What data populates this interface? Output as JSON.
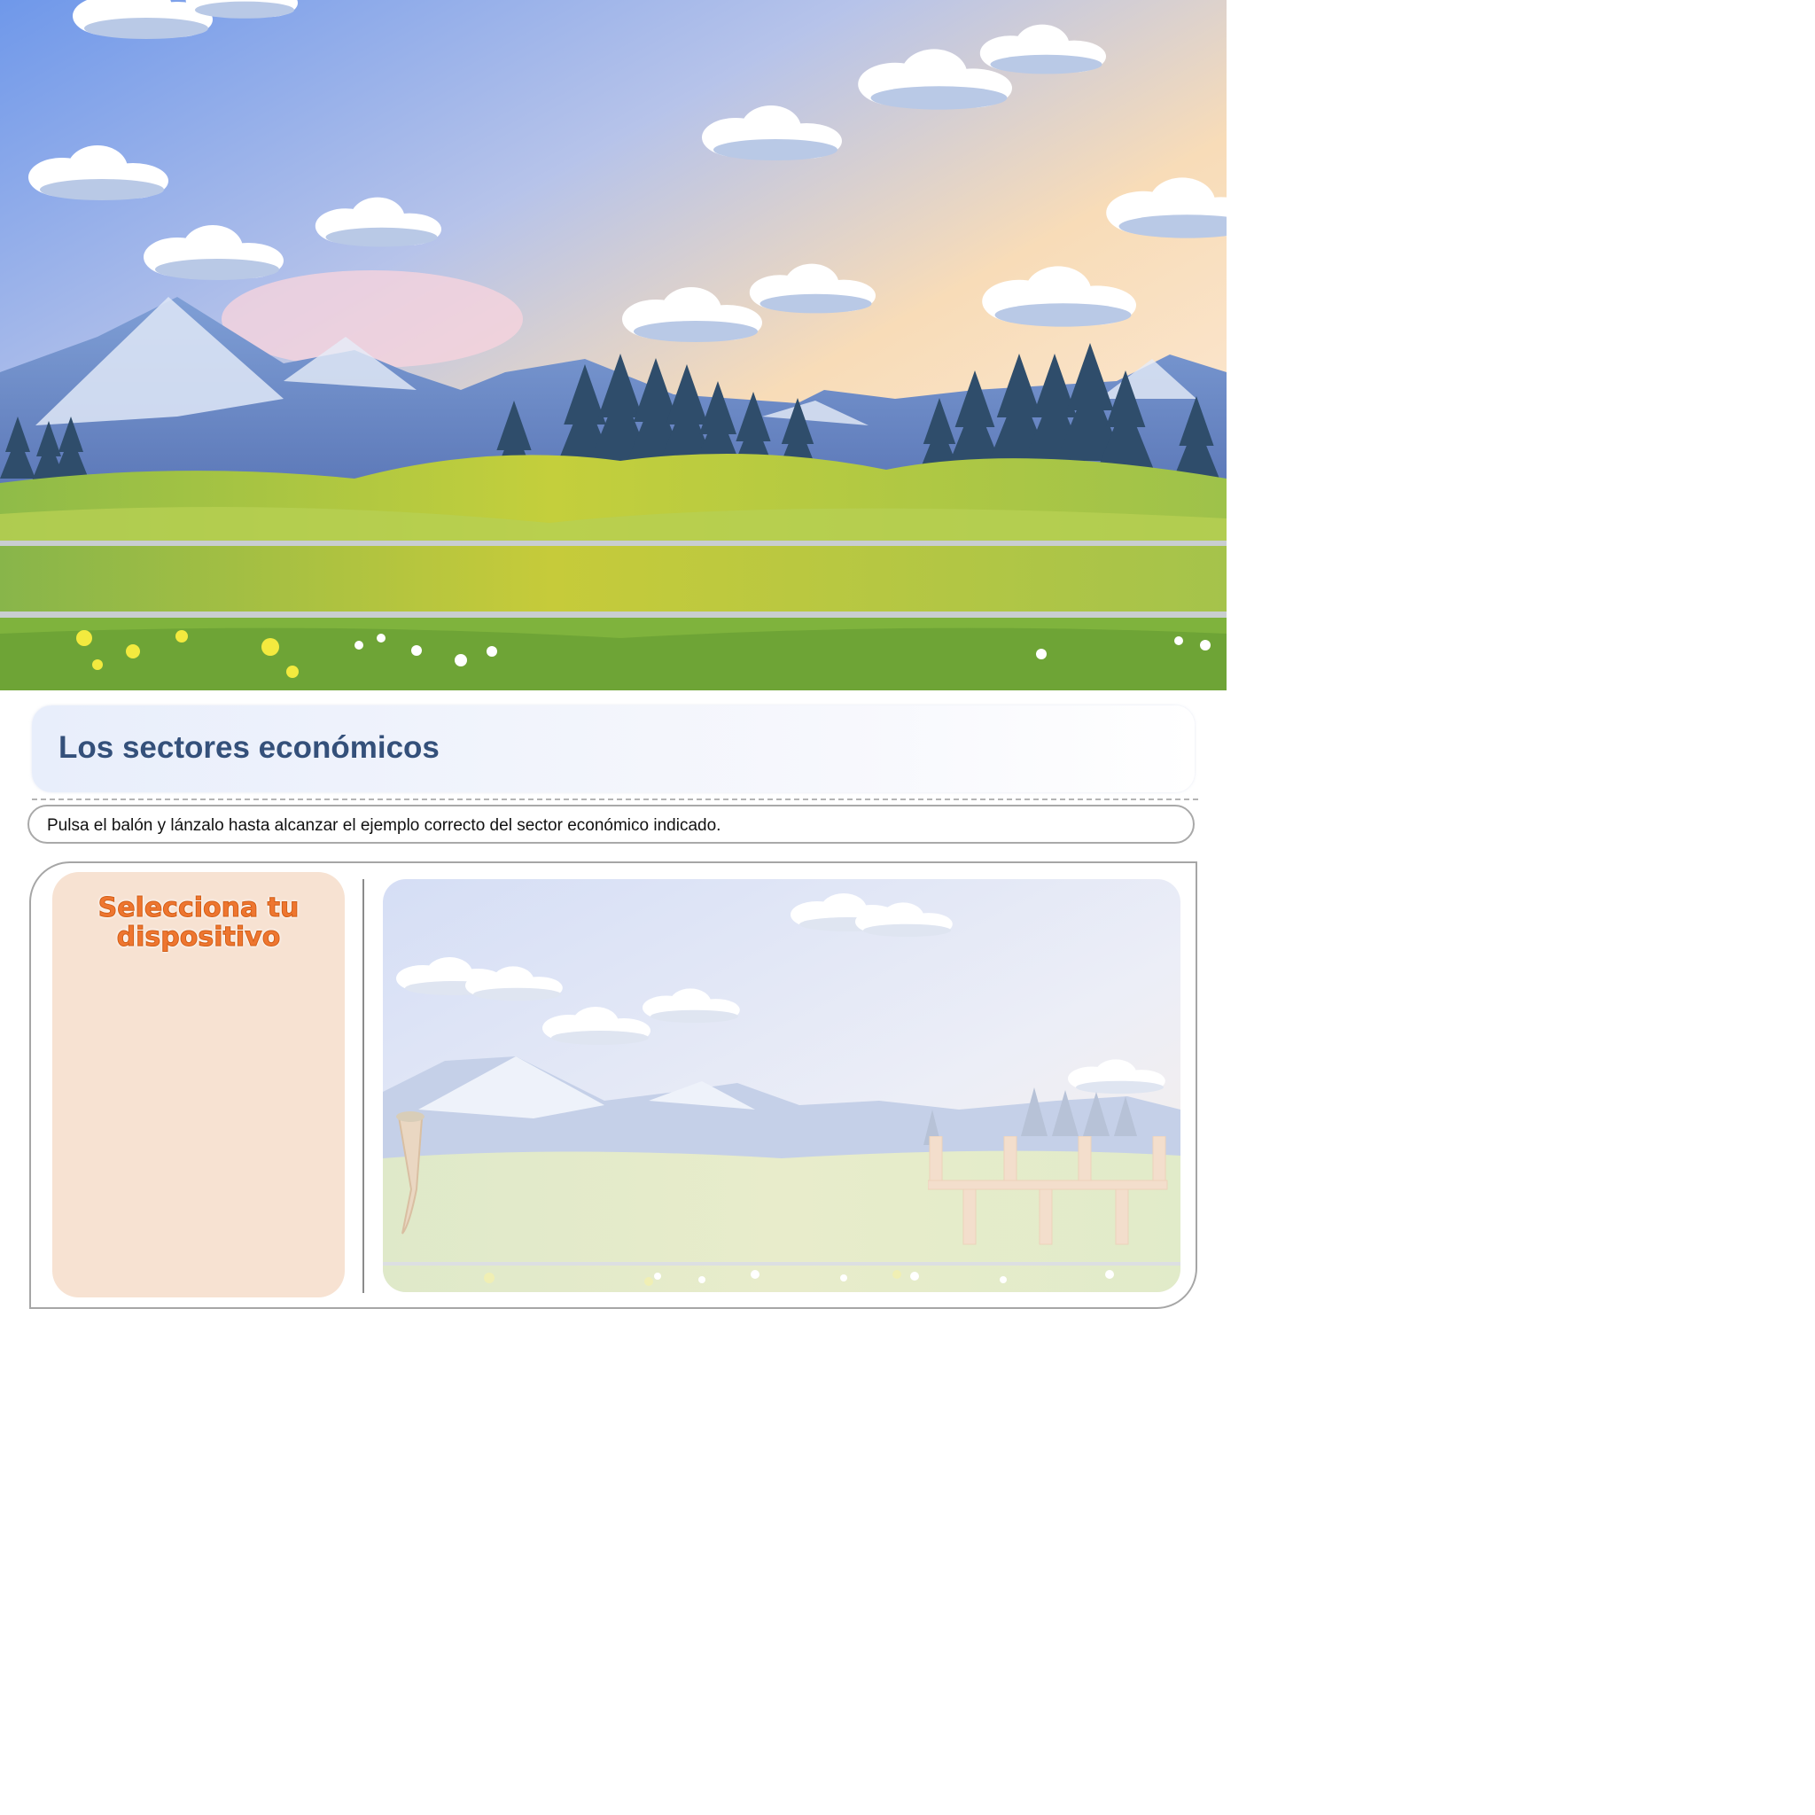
{
  "header": {
    "title": "Los sectores económicos",
    "instructions": "Pulsa el balón y lánzalo hasta alcanzar el ejemplo correcto del sector económico indicado."
  },
  "device_panel": {
    "title": "Selecciona tu dispositivo"
  },
  "colors": {
    "title_text": "#34507a",
    "device_panel_bg": "#f7e2d2",
    "device_title": "#ee7630",
    "frame_border": "#a6a6a6"
  },
  "icons": {
    "goal": "wooden-goal-icon",
    "launcher": "slingshot-icon"
  }
}
